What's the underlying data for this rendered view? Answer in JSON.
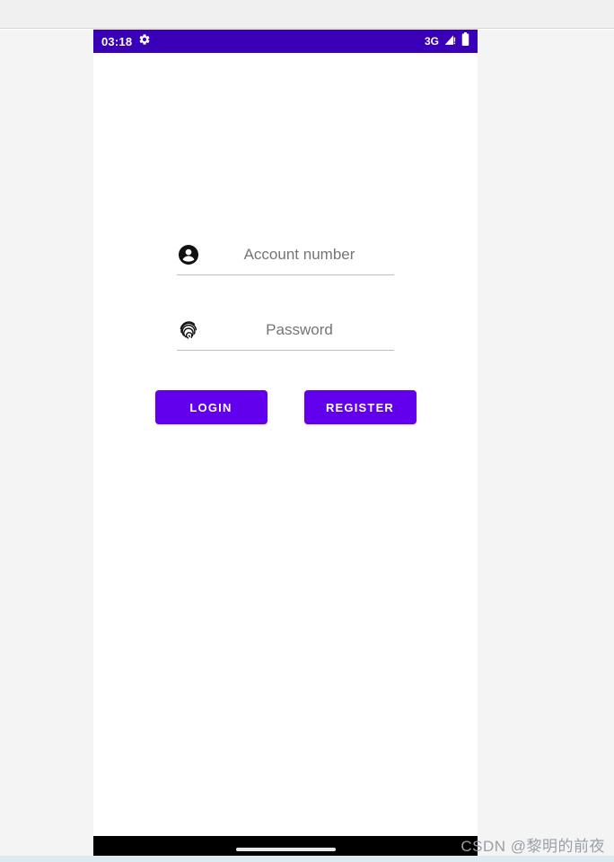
{
  "status_bar": {
    "time": "03:18",
    "gear_icon": "gear-icon",
    "network_label": "3G",
    "signal_icon": "signal-warning-icon",
    "battery_icon": "battery-full-icon",
    "background_color": "#3A00B8",
    "text_color": "#FFFFFF"
  },
  "form": {
    "account": {
      "icon": "account-circle-icon",
      "placeholder": "Account number",
      "value": ""
    },
    "password": {
      "icon": "fingerprint-icon",
      "placeholder": "Password",
      "value": ""
    }
  },
  "buttons": {
    "login_label": "LOGIN",
    "register_label": "REGISTER",
    "accent_color": "#6200EE",
    "label_color": "#FFFFFF"
  },
  "navigation_bar": {
    "gesture_pill": "home-gesture-pill",
    "background_color": "#000000"
  },
  "watermark": {
    "text": "CSDN @黎明的前夜",
    "color": "#9AA0A6"
  }
}
